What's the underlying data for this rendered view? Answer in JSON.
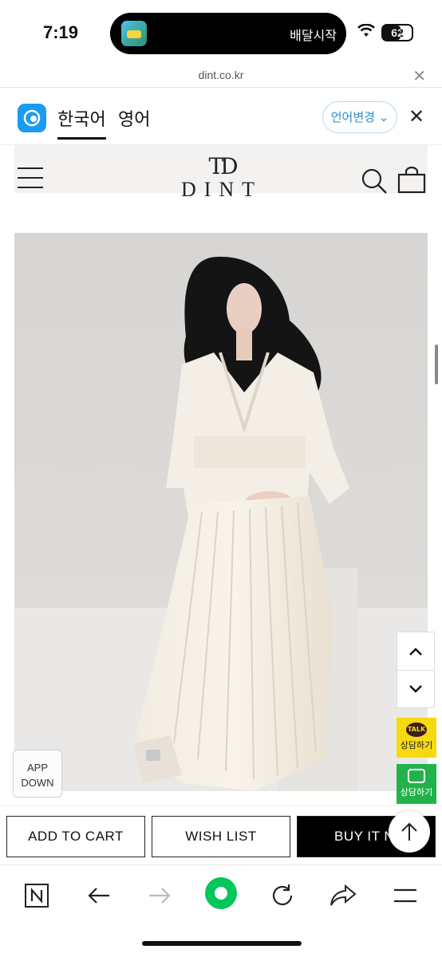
{
  "status_bar": {
    "time": "7:19",
    "island_label": "배달시작",
    "battery": "62",
    "battery_level": 0.62
  },
  "browser": {
    "url": "dint.co.kr"
  },
  "translate_bar": {
    "tab_korean": "한국어",
    "tab_english": "영어",
    "change_language": "언어변경"
  },
  "site": {
    "brand_mark": "TD",
    "brand_name": "DINT"
  },
  "floating": {
    "app_down_line1": "APP",
    "app_down_line2": "DOWN",
    "kakao_badge": "TALK",
    "kakao_label": "상담하기",
    "talk_label": "상담하기"
  },
  "cart_bar": {
    "add_to_cart": "ADD TO CART",
    "wish_list": "WISH LIST",
    "buy_it_now": "BUY IT NO"
  },
  "colors": {
    "kakao": "#f6d910",
    "talk": "#21b34a",
    "naver_green": "#03c75a",
    "link_blue": "#2b8fd8"
  }
}
